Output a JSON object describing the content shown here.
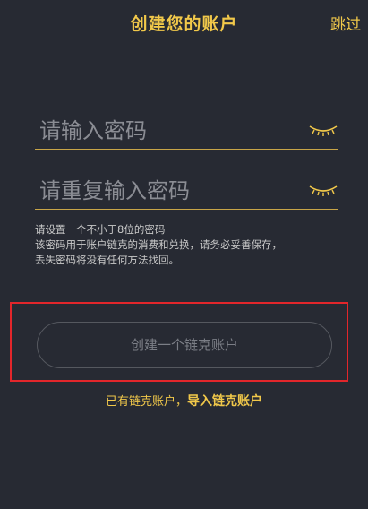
{
  "header": {
    "title": "创建您的账户",
    "skip_label": "跳过"
  },
  "form": {
    "password": {
      "placeholder": "请输入密码",
      "value": "",
      "toggle_icon": "eye-closed-icon"
    },
    "password_repeat": {
      "placeholder": "请重复输入密码",
      "value": "",
      "toggle_icon": "eye-closed-icon"
    },
    "hint_lines": [
      "请设置一个不小于8位的密码",
      "该密码用于账户链克的消费和兑换，请务必妥善保存，",
      "丢失密码将没有任何方法找回。"
    ]
  },
  "actions": {
    "create_label": "创建一个链克账户",
    "have_account_text": "已有链克账户，",
    "import_label": "导入链克账户"
  },
  "colors": {
    "background": "#272a33",
    "accent": "#f1c84a",
    "field_underline": "#c8a548",
    "highlight": "#e2262b",
    "disabled_text": "#7b7e86"
  }
}
